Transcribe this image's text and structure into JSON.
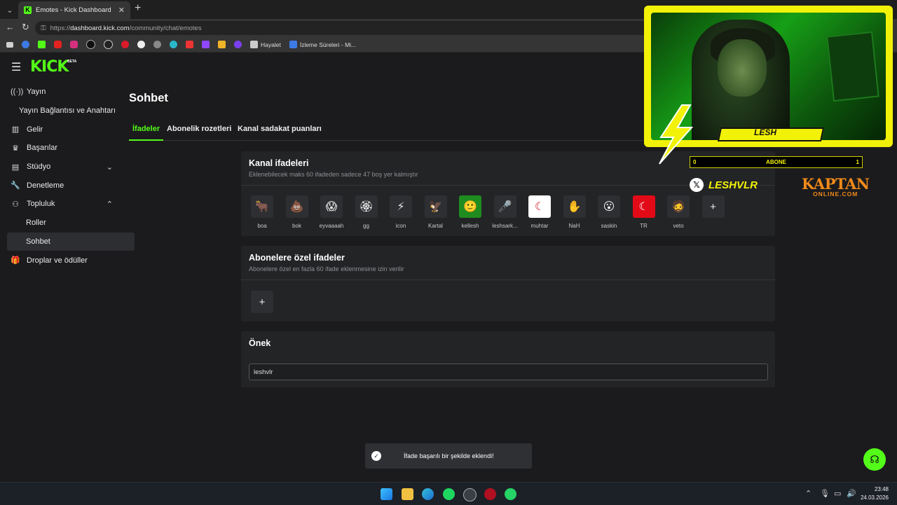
{
  "browser": {
    "tab_title": "Emotes - Kick Dashboard",
    "url_scheme": "https://",
    "url_host": "dashboard.kick.com",
    "url_path": "/community/chat/emotes",
    "bookmarks": [
      {
        "name": "Hayalet"
      },
      {
        "name": "İzleme Süreleri - Mi..."
      }
    ]
  },
  "brand": {
    "logo": "KICK",
    "beta": "BETA"
  },
  "sidebar": {
    "items": [
      {
        "label": "Yayın",
        "icon": "broadcast-icon"
      },
      {
        "label": "Yayın Bağlantısı ve Anahtarı"
      },
      {
        "label": "Gelir",
        "icon": "chart-icon"
      },
      {
        "label": "Başarılar",
        "icon": "trophy-icon"
      },
      {
        "label": "Stüdyo",
        "icon": "studio-icon"
      },
      {
        "label": "Denetleme",
        "icon": "wrench-icon"
      },
      {
        "label": "Topluluk",
        "icon": "community-icon"
      },
      {
        "label": "Roller"
      },
      {
        "label": "Sohbet"
      },
      {
        "label": "Droplar ve ödüller",
        "icon": "gift-icon"
      }
    ]
  },
  "main": {
    "title": "Sohbet",
    "tabs": [
      {
        "label": "İfadeler"
      },
      {
        "label": "Abonelik rozetleri"
      },
      {
        "label": "Kanal sadakat puanları"
      }
    ],
    "channel_emotes": {
      "title": "Kanal ifadeleri",
      "subtitle": "Eklenebilecek maks 60 ifadeden sadece 47 boş yer kalmıştır",
      "emotes": [
        {
          "name": "boa",
          "glyph": "🐂"
        },
        {
          "name": "bok",
          "glyph": "💩"
        },
        {
          "name": "eyvaaaah",
          "glyph": "😱"
        },
        {
          "name": "gg",
          "glyph": "🏵"
        },
        {
          "name": "icon",
          "glyph": "⚡"
        },
        {
          "name": "Kartal",
          "glyph": "🦅"
        },
        {
          "name": "kellesh",
          "glyph": "🙂"
        },
        {
          "name": "leshsark...",
          "glyph": "🎤"
        },
        {
          "name": "muhtar",
          "glyph": "☾"
        },
        {
          "name": "NaH",
          "glyph": "✋"
        },
        {
          "name": "saskin",
          "glyph": "😮"
        },
        {
          "name": "TR",
          "glyph": "☾"
        },
        {
          "name": "veto",
          "glyph": "🧔"
        }
      ],
      "add_label": "+"
    },
    "sub_emotes": {
      "title": "Abonelere özel ifadeler",
      "subtitle": "Abonelere özel en fazla 60 ifade eklenmesine izin verilir",
      "add_label": "+"
    },
    "prefix": {
      "title": "Önek",
      "value": "leshvlr"
    }
  },
  "overlay": {
    "streamer_name": "LESH",
    "abone_left": "0",
    "abone_label": "ABONE",
    "abone_right": "1",
    "x_handle": "LESHVLR",
    "sponsor_line1": "KAPTAN",
    "sponsor_line2": "ONLINE.COM"
  },
  "toast": {
    "text": "İfade başarılı bir şekilde eklendi!"
  },
  "taskbar": {
    "time": "23:48",
    "date": "24.03.2026"
  },
  "colors": {
    "accent": "#53fc18",
    "overlay_yellow": "#f2f208",
    "sponsor_orange": "#f08a1a"
  }
}
